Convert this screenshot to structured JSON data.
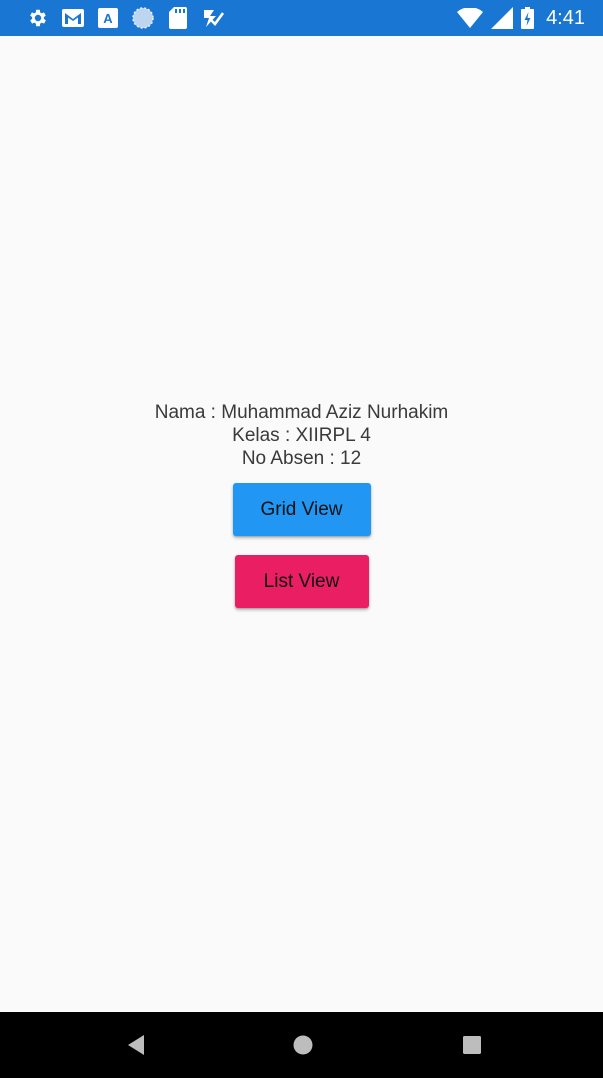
{
  "status_bar": {
    "time": "4:41",
    "background": "#1976d2",
    "left_icons": [
      "settings-icon",
      "gmail-icon",
      "text-a-icon",
      "globe-icon",
      "sd-card-icon",
      "checklist-icon"
    ],
    "right_icons": [
      "wifi-icon",
      "signal-icon",
      "battery-icon"
    ]
  },
  "profile": {
    "nama": "Nama : Muhammad Aziz Nurhakim",
    "kelas": "Kelas : XIIRPL 4",
    "absen": "No Absen : 12"
  },
  "buttons": {
    "grid_view_label": "Grid View",
    "grid_view_color": "#2196f3",
    "list_view_label": "List View",
    "list_view_color": "#e91e63"
  },
  "navigation": {
    "icons": [
      "back-icon",
      "home-icon",
      "recents-icon"
    ]
  }
}
